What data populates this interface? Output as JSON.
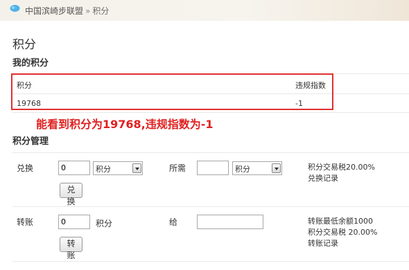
{
  "breadcrumb": {
    "site": "中国滨崎步联盟",
    "separator": "»",
    "current": "积分"
  },
  "page": {
    "title": "积分",
    "my_points_title": "我的积分",
    "management_title": "积分管理"
  },
  "points_table": {
    "headers": [
      "积分",
      "违规指数"
    ],
    "values": [
      "19768",
      "-1"
    ]
  },
  "annotation": "能看到积分为19768,违规指数为-1",
  "exchange": {
    "label": "兑换",
    "amount": "0",
    "unit_option": "积分",
    "need_label": "所需",
    "need_amount": "",
    "need_unit_option": "积分",
    "button": "兑换",
    "tax_text": "积分交易税20.00%",
    "record_link": "兑换记录"
  },
  "transfer": {
    "label": "转账",
    "amount": "0",
    "unit": "积分",
    "to_label": "给",
    "to_value": "",
    "button": "转账",
    "min_balance": "转账最低余额1000",
    "tax_text": "积分交易税  20.00%",
    "record_link": "转账记录"
  },
  "colors": {
    "annotation_red": "#e02020",
    "box_red": "#e03030"
  }
}
